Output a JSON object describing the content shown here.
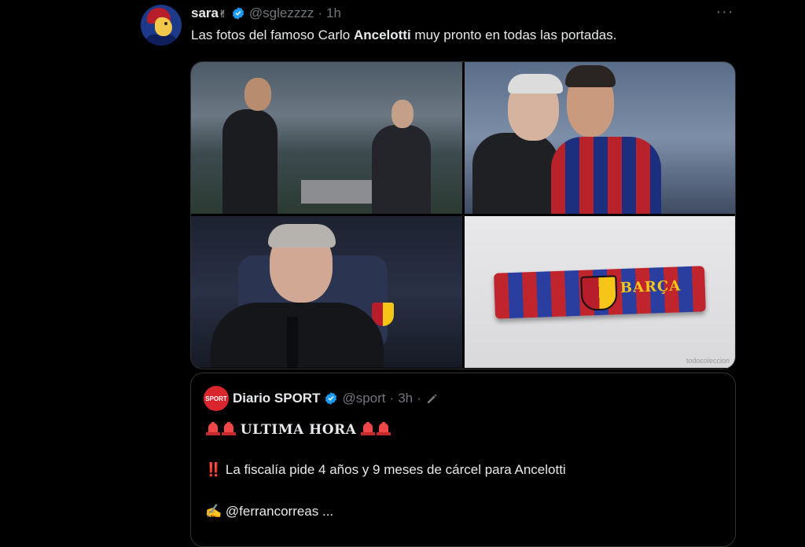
{
  "tweet": {
    "display_name": "sara",
    "name_suffix_glyph": "✌",
    "handle": "@sglezzzz",
    "separator": "·",
    "time": "1h",
    "more": "···",
    "text_before": "Las fotos del famoso Carlo ",
    "text_bold": "Ancelotti",
    "text_after": " muy pronto en todas las portadas.",
    "media": {
      "stick_label": "BARÇA",
      "watermark": "todocoleccion"
    }
  },
  "quote": {
    "avatar_label": "SPORT",
    "display_name": "Diario SPORT",
    "handle": "@sport",
    "separator": "·",
    "time": "3h",
    "separator2": "·",
    "headline": "ULTIMA HORA",
    "bang": "‼️",
    "line2": "La fiscalía pide 4 años y 9 meses de cárcel para Ancelotti",
    "writing_emoji": "✍️",
    "line3": "@ferrancorreas ..."
  },
  "colors": {
    "background": "#000000",
    "text": "#e7e9ea",
    "muted": "#71767b",
    "verified": "#1d9bf0",
    "border": "#2f3336"
  }
}
